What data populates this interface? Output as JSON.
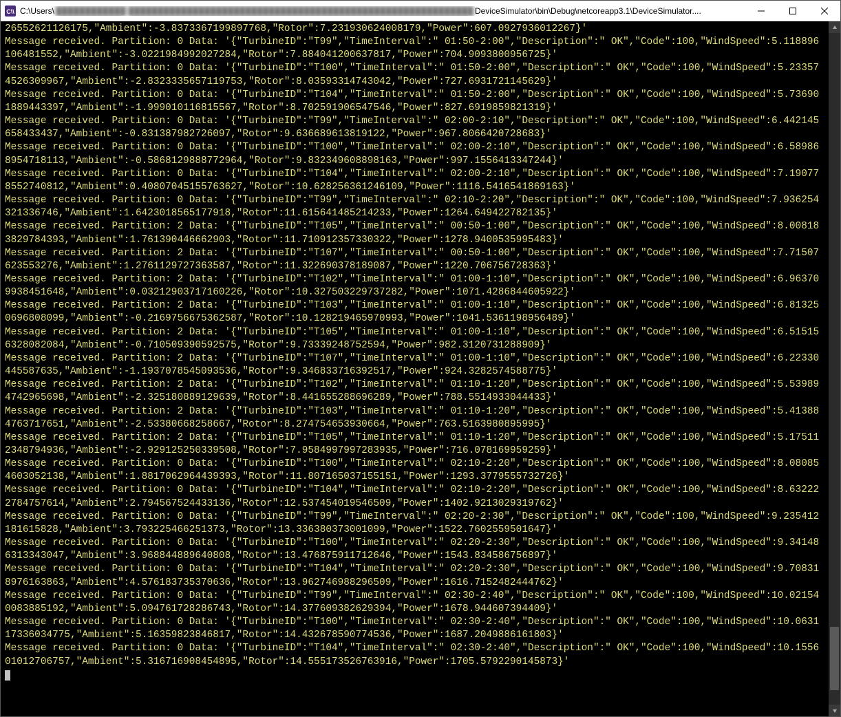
{
  "window": {
    "title_prefix": "C:\\Users\\",
    "title_blurred": "████████████   ███████████████████████████████████████████████████████████",
    "title_suffix": "DeviceSimulator\\bin\\Debug\\netcoreapp3.1\\DeviceSimulator....",
    "icon_label": "app-icon"
  },
  "first_line_tail": "26552621126175,\"Ambient\":-3.8373367199897768,\"Rotor\":7.231930624008179,\"Power\":607.0927936012267}'",
  "messages": [
    {
      "partition": 0,
      "TurbineID": "T99",
      "TimeInterval": " 01:50-2:00",
      "Description": " OK",
      "Code": 100,
      "WindSpeed": 5.118896106481552,
      "Ambient": -3.0221984992027284,
      "Rotor": 7.884041200637817,
      "Power": 704.9093800956725
    },
    {
      "partition": 0,
      "TurbineID": "T100",
      "TimeInterval": " 01:50-2:00",
      "Description": " OK",
      "Code": 100,
      "WindSpeed": 5.233574526309967,
      "Ambient": -2.8323335657119753,
      "Rotor": 8.03593314743042,
      "Power": 727.6931721145629
    },
    {
      "partition": 0,
      "TurbineID": "T104",
      "TimeInterval": " 01:50-2:00",
      "Description": " OK",
      "Code": 100,
      "WindSpeed": 5.736901889443397,
      "Ambient": -1.999010116815567,
      "Rotor": 8.702591906547546,
      "Power": 827.6919859821319
    },
    {
      "partition": 0,
      "TurbineID": "T99",
      "TimeInterval": " 02:00-2:10",
      "Description": " OK",
      "Code": 100,
      "WindSpeed": 6.442145658433437,
      "Ambient": -0.831387982726097,
      "Rotor": 9.636689613819122,
      "Power": 967.8066420728683
    },
    {
      "partition": 0,
      "TurbineID": "T100",
      "TimeInterval": " 02:00-2:10",
      "Description": " OK",
      "Code": 100,
      "WindSpeed": 6.589868954718113,
      "Ambient": -0.5868129888772964,
      "Rotor": 9.832349608898163,
      "Power": 997.1556413347244
    },
    {
      "partition": 0,
      "TurbineID": "T104",
      "TimeInterval": " 02:00-2:10",
      "Description": " OK",
      "Code": 100,
      "WindSpeed": 7.190778552740812,
      "Ambient": 0.40807045155763627,
      "Rotor": 10.628256361246109,
      "Power": 1116.5416541869163
    },
    {
      "partition": 0,
      "TurbineID": "T99",
      "TimeInterval": " 02:10-2:20",
      "Description": " OK",
      "Code": 100,
      "WindSpeed": 7.936254321336746,
      "Ambient": 1.6423018565177918,
      "Rotor": 11.615641485214233,
      "Power": 1264.649422782135
    },
    {
      "partition": 2,
      "TurbineID": "T105",
      "TimeInterval": " 00:50-1:00",
      "Description": " OK",
      "Code": 100,
      "WindSpeed": 8.008183829784393,
      "Ambient": 1.761390446662903,
      "Rotor": 11.710912357330322,
      "Power": 1278.9400535995483
    },
    {
      "partition": 2,
      "TurbineID": "T107",
      "TimeInterval": " 00:50-1:00",
      "Description": " OK",
      "Code": 100,
      "WindSpeed": 7.71507623553276,
      "Ambient": 1.2761129727363587,
      "Rotor": 11.322690378189087,
      "Power": 1220.706756728363
    },
    {
      "partition": 2,
      "TurbineID": "T102",
      "TimeInterval": " 01:00-1:10",
      "Description": " OK",
      "Code": 100,
      "WindSpeed": 6.963709938451648,
      "Ambient": 0.03212903717160226,
      "Rotor": 10.327503229737282,
      "Power": 1071.4286844605922
    },
    {
      "partition": 2,
      "TurbineID": "T103",
      "TimeInterval": " 01:00-1:10",
      "Description": " OK",
      "Code": 100,
      "WindSpeed": 6.813250696808099,
      "Ambient": -0.2169756675362587,
      "Rotor": 10.128219465970993,
      "Power": 1041.5361198956489
    },
    {
      "partition": 2,
      "TurbineID": "T105",
      "TimeInterval": " 01:00-1:10",
      "Description": " OK",
      "Code": 100,
      "WindSpeed": 6.515156328082084,
      "Ambient": -0.710509390592575,
      "Rotor": 9.73339248752594,
      "Power": 982.3120731288909
    },
    {
      "partition": 2,
      "TurbineID": "T107",
      "TimeInterval": " 01:00-1:10",
      "Description": " OK",
      "Code": 100,
      "WindSpeed": 6.22330445587635,
      "Ambient": -1.1937078545093536,
      "Rotor": 9.346833716392517,
      "Power": 924.3282574588775
    },
    {
      "partition": 2,
      "TurbineID": "T102",
      "TimeInterval": " 01:10-1:20",
      "Description": " OK",
      "Code": 100,
      "WindSpeed": 5.539894742965698,
      "Ambient": -2.325180889129639,
      "Rotor": 8.441655288696289,
      "Power": 788.5514933044433
    },
    {
      "partition": 2,
      "TurbineID": "T103",
      "TimeInterval": " 01:10-1:20",
      "Description": " OK",
      "Code": 100,
      "WindSpeed": 5.413884763717651,
      "Ambient": -2.53380668258667,
      "Rotor": 8.274754653930664,
      "Power": 763.5163980895995
    },
    {
      "partition": 2,
      "TurbineID": "T105",
      "TimeInterval": " 01:10-1:20",
      "Description": " OK",
      "Code": 100,
      "WindSpeed": 5.175112348794936,
      "Ambient": -2.929125250339508,
      "Rotor": 7.9584997997283935,
      "Power": 716.078169959259
    },
    {
      "partition": 0,
      "TurbineID": "T100",
      "TimeInterval": " 02:10-2:20",
      "Description": " OK",
      "Code": 100,
      "WindSpeed": 8.080854603052138,
      "Ambient": 1.8817062964439393,
      "Rotor": 11.807165037155151,
      "Power": 1293.3779555732726
    },
    {
      "partition": 0,
      "TurbineID": "T104",
      "TimeInterval": " 02:10-2:20",
      "Description": " OK",
      "Code": 100,
      "WindSpeed": 8.632222784757614,
      "Ambient": 2.794567524433136,
      "Rotor": 12.537454019546509,
      "Power": 1402.9213029319762
    },
    {
      "partition": 0,
      "TurbineID": "T99",
      "TimeInterval": " 02:20-2:30",
      "Description": " OK",
      "Code": 100,
      "WindSpeed": 9.235412181615828,
      "Ambient": 3.793225466251373,
      "Rotor": 13.336380373001099,
      "Power": 1522.7602559501647
    },
    {
      "partition": 0,
      "TurbineID": "T100",
      "TimeInterval": " 02:20-2:30",
      "Description": " OK",
      "Code": 100,
      "WindSpeed": 9.341486313343047,
      "Ambient": 3.968844889640808,
      "Rotor": 13.476875911712646,
      "Power": 1543.834586756897
    },
    {
      "partition": 0,
      "TurbineID": "T104",
      "TimeInterval": " 02:20-2:30",
      "Description": " OK",
      "Code": 100,
      "WindSpeed": 9.708318976163863,
      "Ambient": 4.576183735370636,
      "Rotor": 13.962746988296509,
      "Power": 1616.7152482444762
    },
    {
      "partition": 0,
      "TurbineID": "T99",
      "TimeInterval": " 02:30-2:40",
      "Description": " OK",
      "Code": 100,
      "WindSpeed": 10.021540083885192,
      "Ambient": 5.094761728286743,
      "Rotor": 14.377609382629394,
      "Power": 1678.944607394409
    },
    {
      "partition": 0,
      "TurbineID": "T100",
      "TimeInterval": " 02:30-2:40",
      "Description": " OK",
      "Code": 100,
      "WindSpeed": 10.063117336034775,
      "Ambient": 5.16359823846817,
      "Rotor": 14.432678590774536,
      "Power": 1687.2049886161803
    },
    {
      "partition": 0,
      "TurbineID": "T104",
      "TimeInterval": " 02:30-2:40",
      "Description": " OK",
      "Code": 100,
      "WindSpeed": 10.155601012706757,
      "Ambient": 5.316716908454895,
      "Rotor": 14.555173526763916,
      "Power": 1705.5792290145873
    }
  ]
}
